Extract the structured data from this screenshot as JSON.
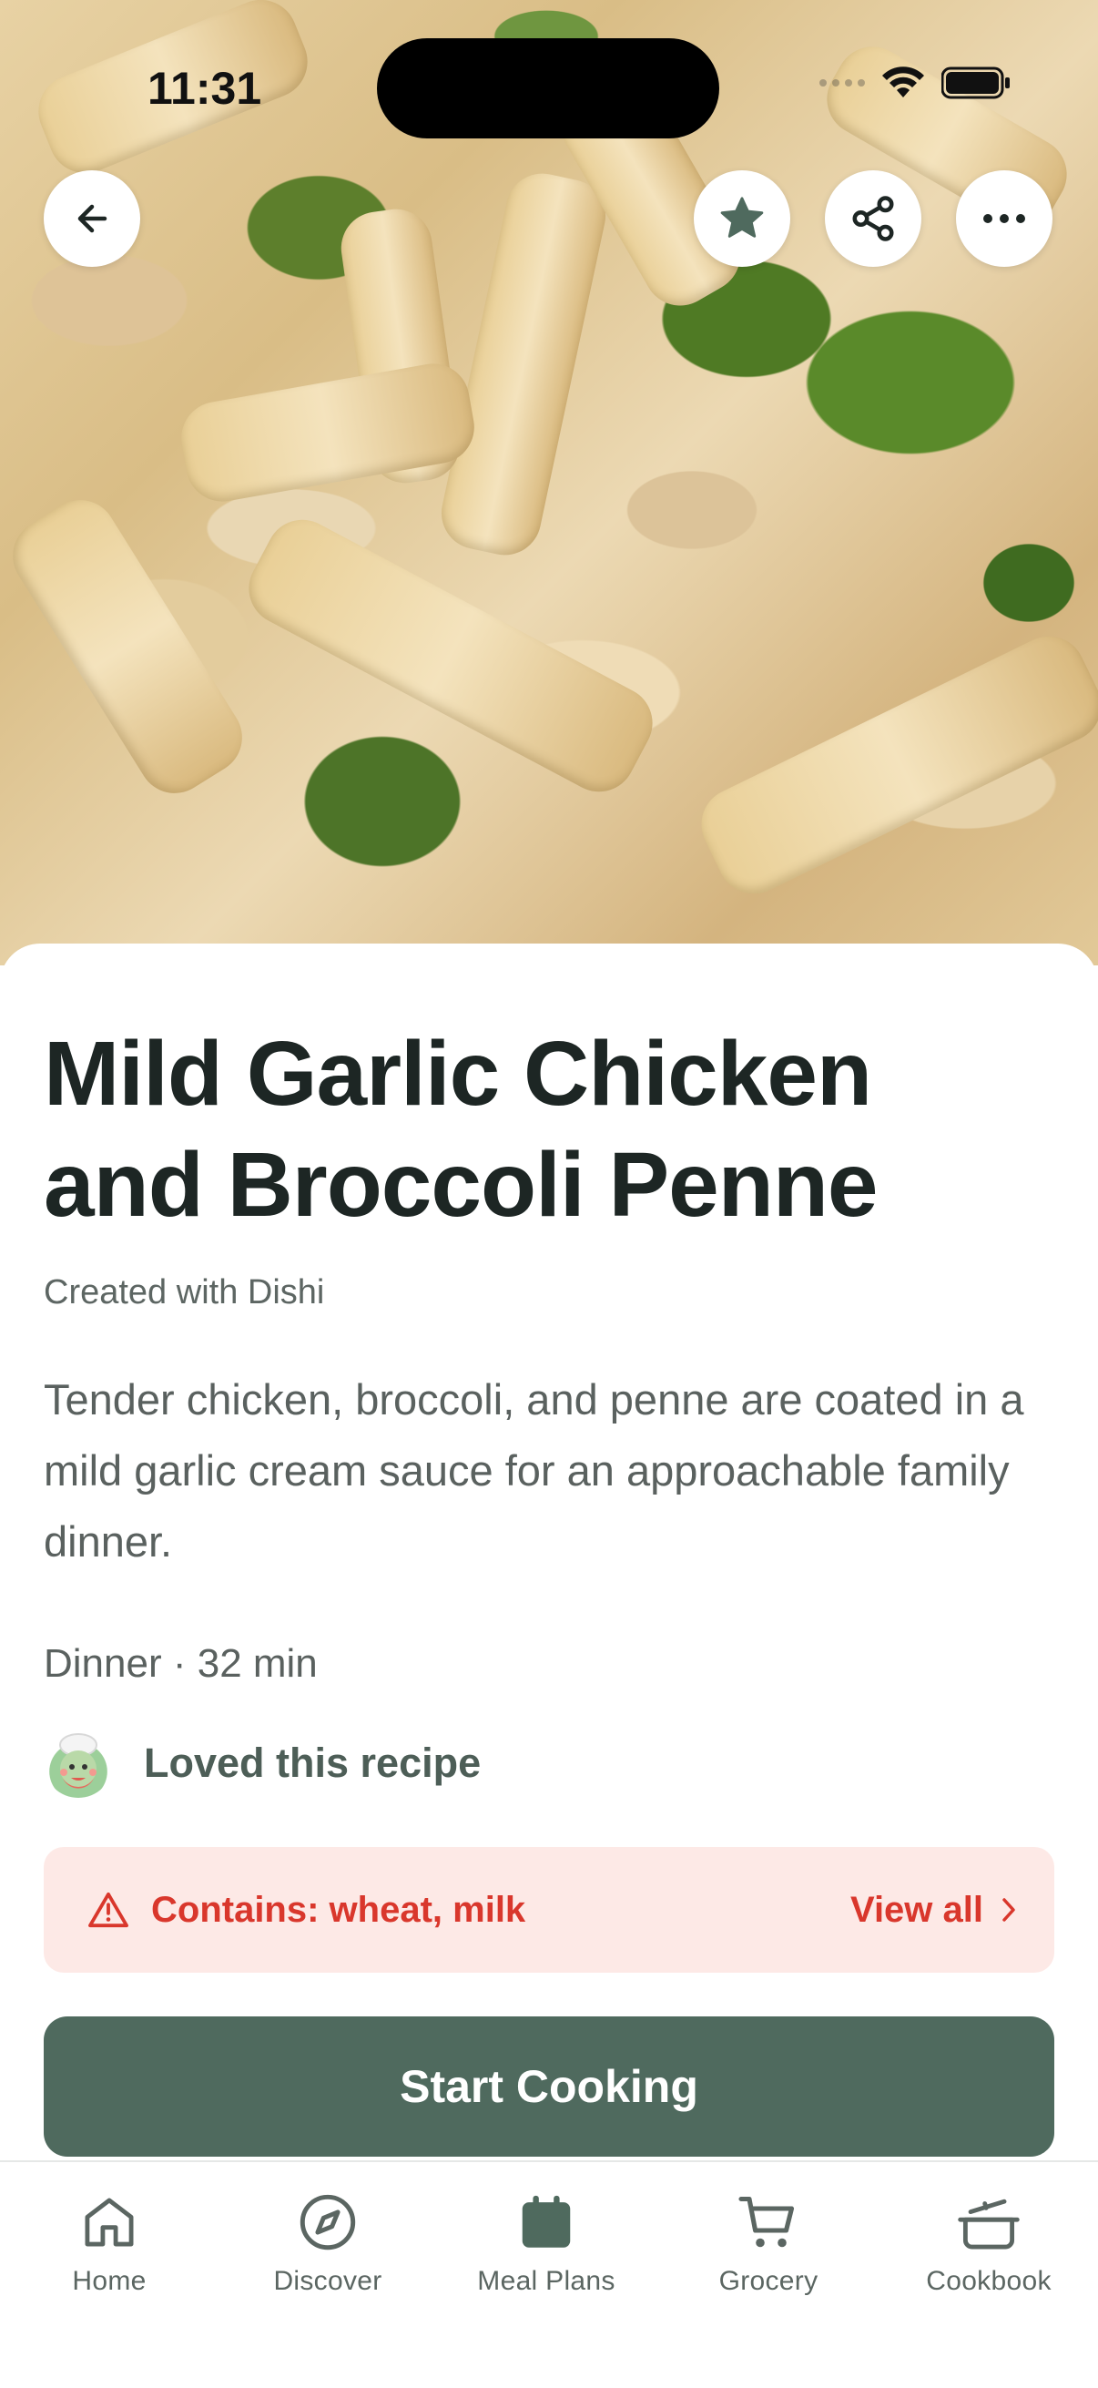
{
  "status_bar": {
    "time": "11:31"
  },
  "recipe": {
    "title_line1": "Mild Garlic Chicken",
    "title_line2": "and Broccoli Penne",
    "created": "Created with Dishi",
    "description": "Tender chicken, broccoli, and penne are coated in a mild garlic cream sauce for an approachable family dinner.",
    "meta": "Dinner · 32 min",
    "loved": "Loved this recipe"
  },
  "allergens": {
    "text": "Contains: wheat, milk",
    "view_all": "View all"
  },
  "actions": {
    "start_cooking": "Start Cooking"
  },
  "tabs": [
    {
      "label": "Home",
      "icon": "home-icon"
    },
    {
      "label": "Discover",
      "icon": "compass-icon"
    },
    {
      "label": "Meal Plans",
      "icon": "calendar-icon"
    },
    {
      "label": "Grocery",
      "icon": "cart-icon"
    },
    {
      "label": "Cookbook",
      "icon": "pot-icon"
    }
  ],
  "colors": {
    "primary": "#4f6a5e",
    "allergen_bg": "#fde9e6",
    "allergen_text": "#d9372c",
    "title": "#1d2624"
  }
}
